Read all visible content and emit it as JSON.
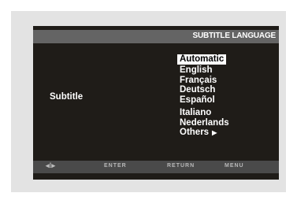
{
  "header": {
    "title": "SUBTITLE LANGUAGE"
  },
  "setting": {
    "label": "Subtitle"
  },
  "options": [
    {
      "label": "Automatic",
      "selected": true
    },
    {
      "label": "English"
    },
    {
      "label": "Français"
    },
    {
      "label": "Deutsch"
    },
    {
      "label": "Español"
    },
    {
      "label": "Italiano"
    },
    {
      "label": "Nederlands"
    },
    {
      "label": "Others"
    }
  ],
  "others_arrow": "▶",
  "footer": {
    "nav": "◂⁞▸",
    "enter": "ENTER",
    "return": "RETURN",
    "menu": "MENU"
  },
  "colors": {
    "screen_bg": "#1f1c18",
    "header_bg": "#646464",
    "footer_bg": "#4a4a4a",
    "highlight": "#ffffff"
  }
}
